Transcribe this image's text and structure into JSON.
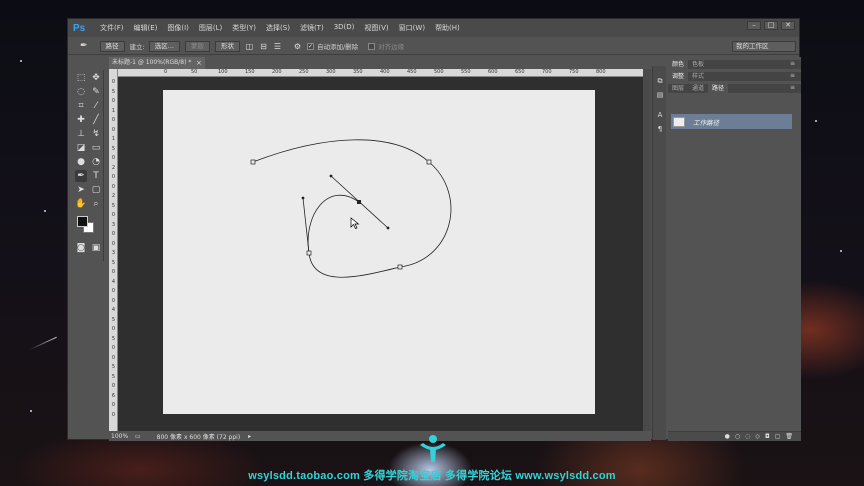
{
  "app": {
    "logo": "Ps",
    "menu": [
      "文件(F)",
      "编辑(E)",
      "图像(I)",
      "图层(L)",
      "类型(Y)",
      "选择(S)",
      "滤镜(T)",
      "3D(D)",
      "视图(V)",
      "窗口(W)",
      "帮助(H)"
    ],
    "window_controls": [
      "minimize-icon",
      "maximize-icon",
      "close-icon"
    ]
  },
  "options_bar": {
    "mode_select": "路径",
    "make_label": "建立:",
    "selection_button": "选区...",
    "mask_button": "蒙版",
    "shape_button": "形状",
    "auto_add_delete": "自动添加/删除",
    "align_edges": "对齐边缘",
    "workspace": "我的工作区"
  },
  "document": {
    "tab_title": "未标题-1 @ 100%(RGB/8) *",
    "ruler_top_ticks": [
      "0",
      "50",
      "100",
      "150",
      "200",
      "250",
      "300",
      "350",
      "400",
      "450",
      "500",
      "550",
      "600",
      "650",
      "700",
      "750",
      "800"
    ],
    "ruler_left_ticks": [
      "0",
      "5",
      "0",
      "1",
      "0",
      "0",
      "1",
      "5",
      "0",
      "2",
      "0",
      "0",
      "2",
      "5",
      "0",
      "3",
      "0",
      "0",
      "3",
      "5",
      "0",
      "4",
      "0",
      "0",
      "4",
      "5",
      "0",
      "5",
      "0",
      "0",
      "5",
      "5",
      "0",
      "6",
      "0",
      "0"
    ],
    "status_zoom": "100%",
    "status_info": "800 像素 x 600 像素 (72 ppi)"
  },
  "panels": {
    "group1_tabs": [
      "颜色",
      "色板"
    ],
    "group2_tabs": [
      "调整",
      "样式"
    ],
    "group3_tabs": [
      "图层",
      "通道",
      "路径"
    ],
    "active_tab": "路径",
    "path_item": "工作路径"
  },
  "watermark": {
    "text": "wsylsdd.taobao.com  多得学院淘宝店        多得学院论坛  www.wsylsdd.com"
  },
  "colors": {
    "canvas": "#ebebeb",
    "ps_blue": "#39a3f2",
    "selected_row": "#6c7e95",
    "watermark": "#33d3d8"
  }
}
